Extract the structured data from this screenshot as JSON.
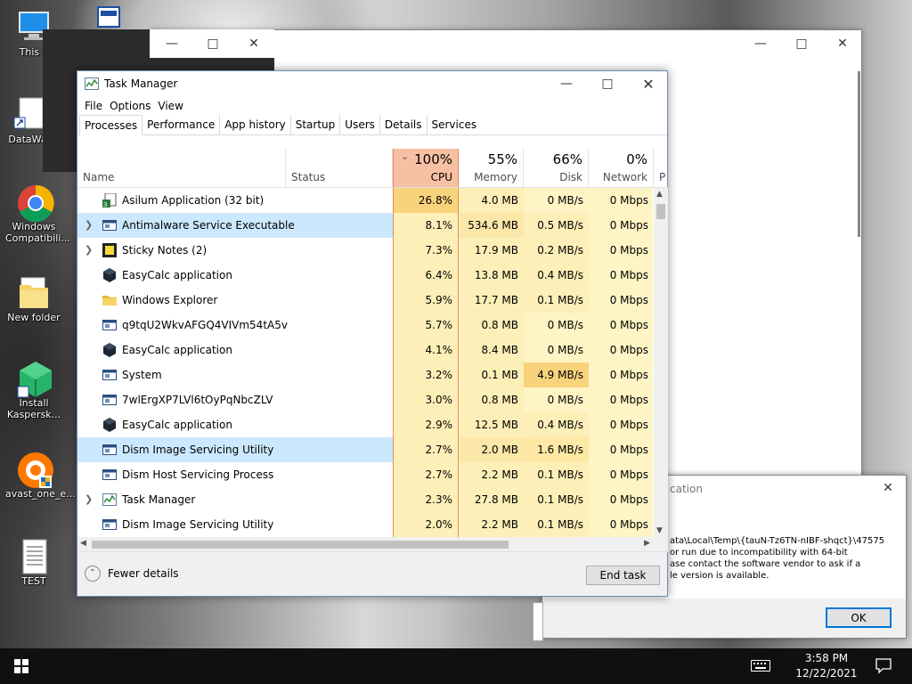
{
  "desktop": {
    "icons": [
      {
        "label": "This PC",
        "shown": "This P"
      },
      {
        "label": "DataWac",
        "shown": "DataWac"
      },
      {
        "label": "Windows Compatibili...",
        "shown": "Windows Compatibili..."
      },
      {
        "label": "New folder",
        "shown": "New folder"
      },
      {
        "label": "Install Kaspersk...",
        "shown": "Install Kaspersk..."
      },
      {
        "label": "avast_one_e...",
        "shown": "avast_one_e..."
      },
      {
        "label": "TEST",
        "shown": "TEST"
      }
    ]
  },
  "task_manager": {
    "title": "Task Manager",
    "menu": [
      "File",
      "Options",
      "View"
    ],
    "tabs": [
      "Processes",
      "Performance",
      "App history",
      "Startup",
      "Users",
      "Details",
      "Services"
    ],
    "active_tab": "Processes",
    "columns": {
      "name": "Name",
      "status": "Status",
      "cpu": {
        "pct": "100%",
        "label": "CPU",
        "sorted": true
      },
      "memory": {
        "pct": "55%",
        "label": "Memory"
      },
      "disk": {
        "pct": "66%",
        "label": "Disk"
      },
      "network": {
        "pct": "0%",
        "label": "Network"
      },
      "power": {
        "label": "P"
      }
    },
    "processes": [
      {
        "name": "Asilum Application (32 bit)",
        "expand": false,
        "icon": "app-32bit-icon",
        "cpu": "26.8%",
        "mem": "4.0 MB",
        "disk": "0 MB/s",
        "net": "0 Mbps",
        "cpu_heat": "#f9d37c",
        "disk_heat": "#fff4c4",
        "selected": false
      },
      {
        "name": "Antimalware Service Executable",
        "expand": true,
        "icon": "service-icon",
        "cpu": "8.1%",
        "mem": "534.6 MB",
        "disk": "0.5 MB/s",
        "net": "0 Mbps",
        "cpu_heat": "#fdefb8",
        "disk_heat": "#fdefb8",
        "selected": true
      },
      {
        "name": "Sticky Notes (2)",
        "expand": true,
        "icon": "sticky-notes-icon",
        "cpu": "7.3%",
        "mem": "17.9 MB",
        "disk": "0.2 MB/s",
        "net": "0 Mbps",
        "cpu_heat": "#fdefb8",
        "disk_heat": "#fdefb8",
        "selected": false
      },
      {
        "name": "EasyCalc application",
        "expand": false,
        "icon": "easycalc-icon",
        "cpu": "6.4%",
        "mem": "13.8 MB",
        "disk": "0.4 MB/s",
        "net": "0 Mbps",
        "cpu_heat": "#fdefb8",
        "disk_heat": "#fdefb8",
        "selected": false
      },
      {
        "name": "Windows Explorer",
        "expand": false,
        "icon": "folder-icon",
        "cpu": "5.9%",
        "mem": "17.7 MB",
        "disk": "0.1 MB/s",
        "net": "0 Mbps",
        "cpu_heat": "#fdefb8",
        "disk_heat": "#fdefb8",
        "selected": false
      },
      {
        "name": "q9tqU2WkvAFGQ4VIVm54tA5v",
        "expand": false,
        "icon": "service-icon",
        "cpu": "5.7%",
        "mem": "0.8 MB",
        "disk": "0 MB/s",
        "net": "0 Mbps",
        "cpu_heat": "#fdefb8",
        "disk_heat": "#fff4c4",
        "selected": false
      },
      {
        "name": "EasyCalc application",
        "expand": false,
        "icon": "easycalc-icon",
        "cpu": "4.1%",
        "mem": "8.4 MB",
        "disk": "0 MB/s",
        "net": "0 Mbps",
        "cpu_heat": "#fdefb8",
        "disk_heat": "#fff4c4",
        "selected": false
      },
      {
        "name": "System",
        "expand": false,
        "icon": "service-icon",
        "cpu": "3.2%",
        "mem": "0.1 MB",
        "disk": "4.9 MB/s",
        "net": "0 Mbps",
        "cpu_heat": "#fdefb8",
        "disk_heat": "#f9d37c",
        "selected": false
      },
      {
        "name": "7wlErgXP7LVl6tOyPqNbcZLV",
        "expand": false,
        "icon": "service-icon",
        "cpu": "3.0%",
        "mem": "0.8 MB",
        "disk": "0 MB/s",
        "net": "0 Mbps",
        "cpu_heat": "#fdefb8",
        "disk_heat": "#fff4c4",
        "selected": false
      },
      {
        "name": "EasyCalc application",
        "expand": false,
        "icon": "easycalc-icon",
        "cpu": "2.9%",
        "mem": "12.5 MB",
        "disk": "0.4 MB/s",
        "net": "0 Mbps",
        "cpu_heat": "#fdefb8",
        "disk_heat": "#fdefb8",
        "selected": false
      },
      {
        "name": "Dism Image Servicing Utility",
        "expand": false,
        "icon": "service-icon",
        "cpu": "2.7%",
        "mem": "2.0 MB",
        "disk": "1.6 MB/s",
        "net": "0 Mbps",
        "cpu_heat": "#fdefb8",
        "disk_heat": "#fde8a5",
        "selected": true
      },
      {
        "name": "Dism Host Servicing Process",
        "expand": false,
        "icon": "service-icon",
        "cpu": "2.7%",
        "mem": "2.2 MB",
        "disk": "0.1 MB/s",
        "net": "0 Mbps",
        "cpu_heat": "#fdefb8",
        "disk_heat": "#fdefb8",
        "selected": false
      },
      {
        "name": "Task Manager",
        "expand": true,
        "icon": "task-manager-icon",
        "cpu": "2.3%",
        "mem": "27.8 MB",
        "disk": "0.1 MB/s",
        "net": "0 Mbps",
        "cpu_heat": "#fdefb8",
        "disk_heat": "#fdefb8",
        "selected": false
      },
      {
        "name": "Dism Image Servicing Utility",
        "expand": false,
        "icon": "service-icon",
        "cpu": "2.0%",
        "mem": "2.2 MB",
        "disk": "0.1 MB/s",
        "net": "0 Mbps",
        "cpu_heat": "#fdefb8",
        "disk_heat": "#fdefb8",
        "selected": false
      }
    ],
    "fewer_details": "Fewer details",
    "end_task": "End task"
  },
  "error_dialog": {
    "title_partial": "cation",
    "message_lines": [
      "ata\\Local\\Temp\\{tauN-Tz6TN-nIBF-shqct}\\47575",
      "or run due to incompatibility with 64-bit",
      "ase contact the software vendor to ask if a",
      "le version is available."
    ],
    "ok": "OK"
  },
  "taskbar": {
    "time": "3:58 PM",
    "date": "12/22/2021"
  }
}
